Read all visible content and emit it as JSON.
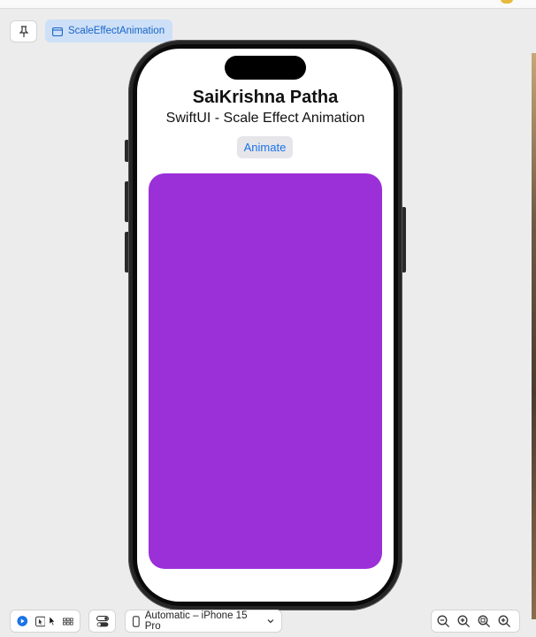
{
  "canvas_tab": {
    "label": "ScaleEffectAnimation"
  },
  "app": {
    "title": "SaiKrishna Patha",
    "subtitle": "SwiftUI - Scale Effect Animation",
    "animate_button": "Animate",
    "rect_color": "#9b30d9"
  },
  "bottom_bar": {
    "device_selector": "Automatic – iPhone 15 Pro"
  },
  "icons": [
    "pin-icon",
    "window-icon",
    "live-preview-icon",
    "selectable-icon",
    "grid-icon",
    "variants-icon",
    "device-icon",
    "chevron-down-icon",
    "zoom-out-icon",
    "zoom-in-icon",
    "zoom-fit-icon",
    "zoom-actual-icon"
  ],
  "colors": {
    "accent": "#1a73e8",
    "crumb_bg": "#cde0f7"
  }
}
